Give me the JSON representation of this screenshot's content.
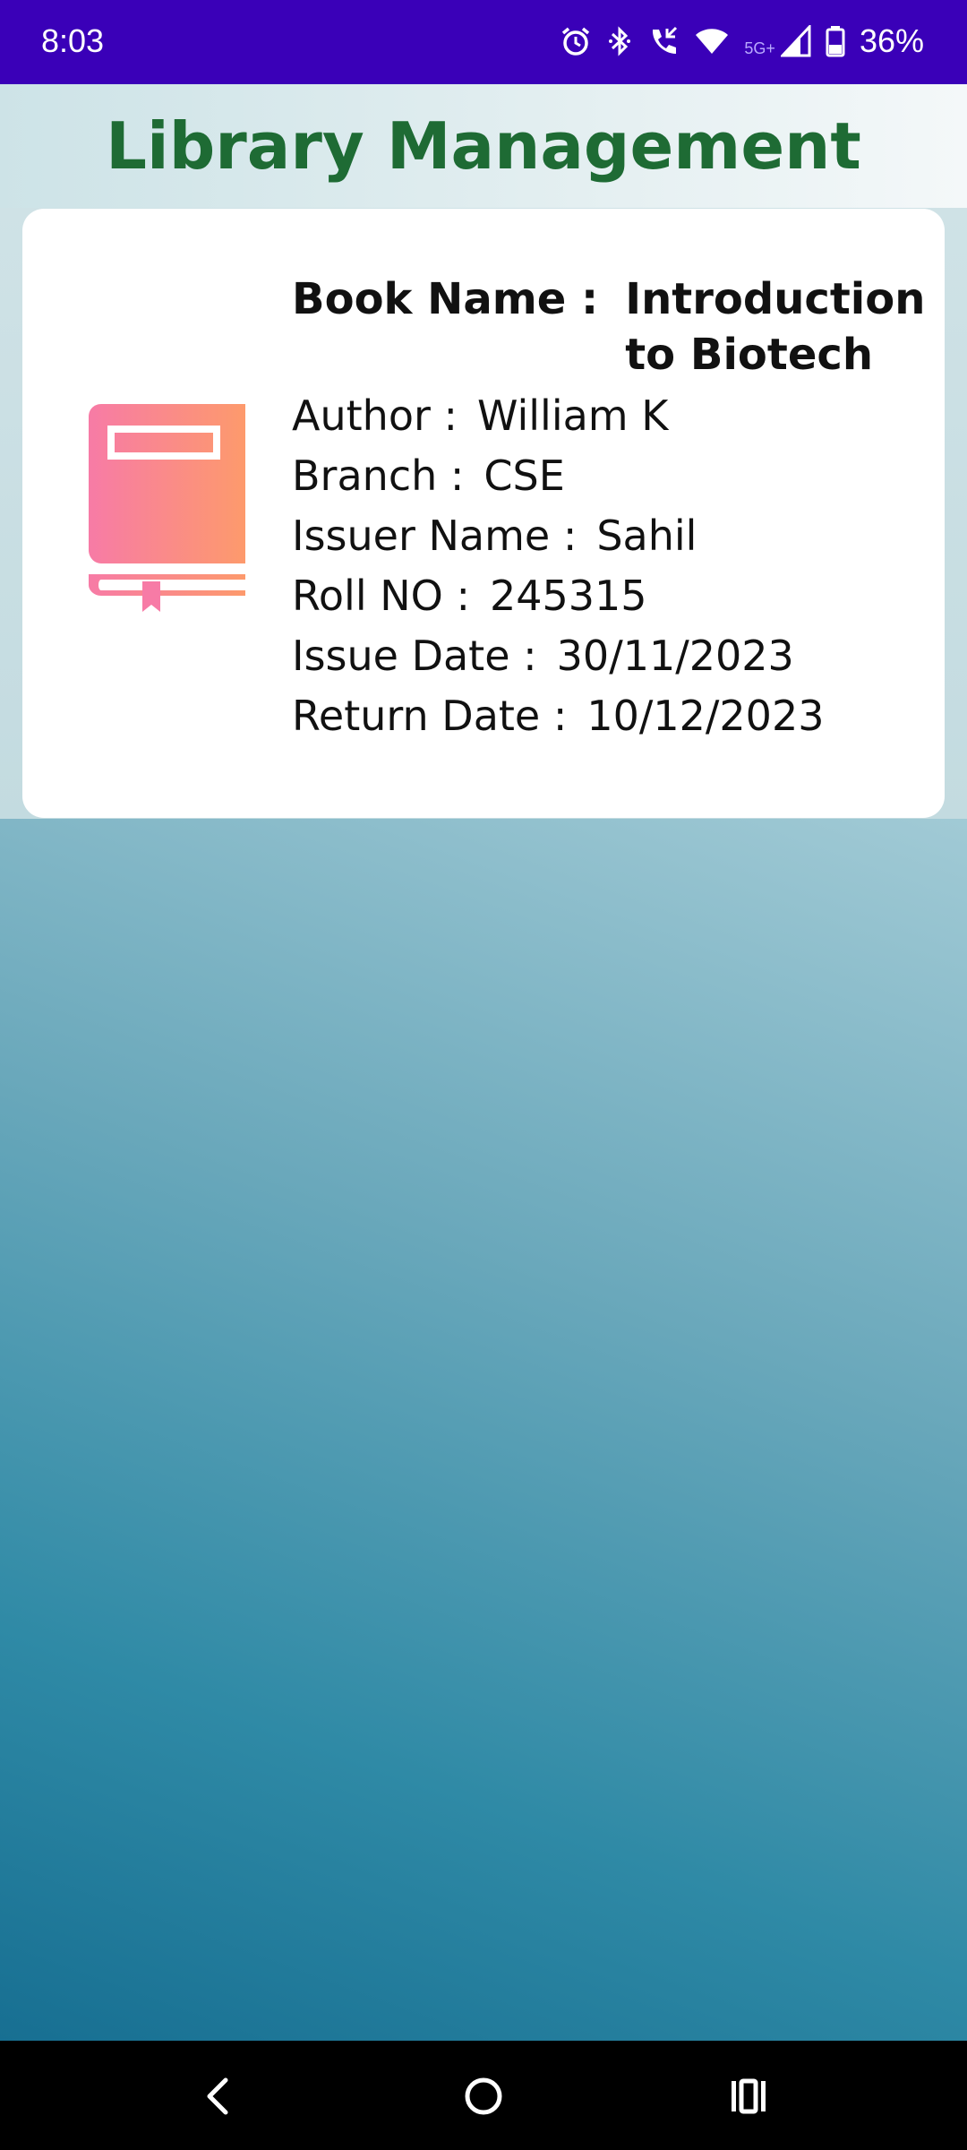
{
  "status_bar": {
    "time": "8:03",
    "network": "5G+",
    "battery": "36%",
    "icons": [
      "alarm-icon",
      "bluetooth-icon",
      "call-icon",
      "wifi-icon",
      "signal-icon",
      "battery-icon"
    ]
  },
  "header": {
    "title": "Library Management"
  },
  "card": {
    "icon": "book-icon",
    "icon_colors": [
      "#f77ba6",
      "#fd9a6c"
    ],
    "book_name_label": "Book Name :",
    "book_name": "Introduction to Biotech",
    "author_label": "Author :",
    "author": "William K",
    "branch_label": "Branch :",
    "branch": "CSE",
    "issuer_label": "Issuer Name :",
    "issuer": "Sahil",
    "roll_label": "Roll NO :",
    "roll": "245315",
    "issue_date_label": "Issue Date :",
    "issue_date": "30/11/2023",
    "return_date_label": "Return Date :",
    "return_date": "10/12/2023"
  },
  "nav_bar": {
    "icons": [
      "back-icon",
      "home-icon",
      "recents-icon"
    ]
  },
  "colors": {
    "status_bar": "#3a00b8",
    "title": "#1e6b34",
    "background_top": "#c8dee3",
    "background_bottom": "#176f92"
  }
}
